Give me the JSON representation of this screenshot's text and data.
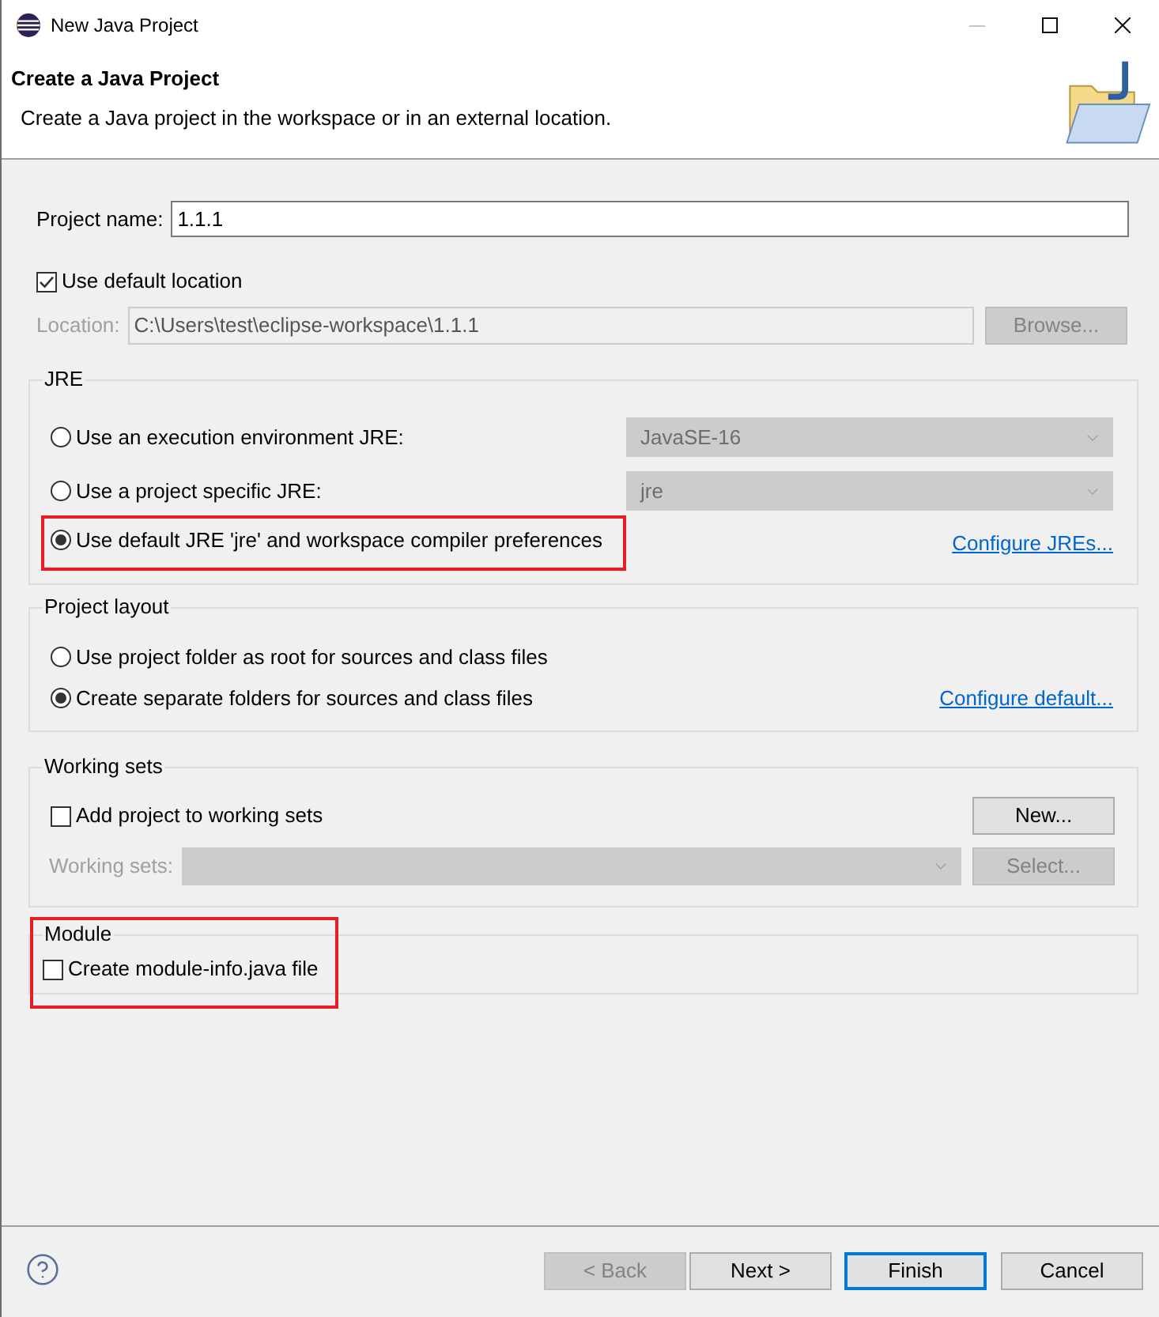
{
  "window": {
    "title": "New Java Project"
  },
  "header": {
    "title": "Create a Java Project",
    "description": "Create a Java project in the workspace or in an external location."
  },
  "project_name": {
    "label": "Project name:",
    "value": "1.1.1"
  },
  "use_default_location": {
    "label": "Use default location",
    "checked": true
  },
  "location": {
    "label": "Location:",
    "value": "C:\\Users\\test\\eclipse-workspace\\1.1.1",
    "disabled": true,
    "browse_button": "Browse..."
  },
  "jre": {
    "title": "JRE",
    "options": [
      {
        "label": "Use an execution environment JRE:",
        "selected": false,
        "highlighted": false,
        "dropdown": {
          "value": "JavaSE-16",
          "disabled": true
        }
      },
      {
        "label": "Use a project specific JRE:",
        "selected": false,
        "highlighted": false,
        "dropdown": {
          "value": "jre",
          "disabled": true
        }
      },
      {
        "label": "Use default JRE 'jre' and workspace compiler preferences",
        "selected": true,
        "highlighted": true,
        "link": "Configure JREs..."
      }
    ]
  },
  "project_layout": {
    "title": "Project layout",
    "options": [
      {
        "label": "Use project folder as root for sources and class files",
        "selected": false
      },
      {
        "label": "Create separate folders for sources and class files",
        "selected": true,
        "link": "Configure default..."
      }
    ]
  },
  "working_sets": {
    "title": "Working sets",
    "add": {
      "label": "Add project to working sets",
      "checked": false
    },
    "new_button": "New...",
    "sets_label": "Working sets:",
    "disabled": true,
    "select_button": "Select..."
  },
  "module": {
    "title": "Module",
    "highlighted": true,
    "create": {
      "label": "Create module-info.java file",
      "checked": false
    }
  },
  "footer": {
    "buttons": [
      {
        "label": "< Back",
        "disabled": true,
        "default": false
      },
      {
        "label": "Next >",
        "disabled": false,
        "default": false
      },
      {
        "label": "Finish",
        "disabled": false,
        "default": true
      },
      {
        "label": "Cancel",
        "disabled": false,
        "default": false
      }
    ]
  }
}
